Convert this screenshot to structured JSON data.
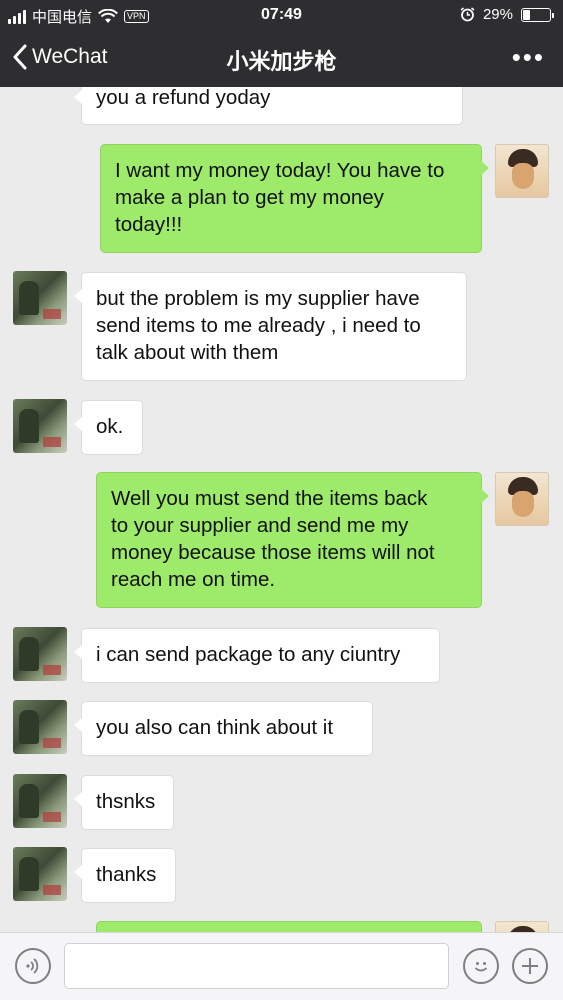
{
  "status_bar": {
    "carrier": "中国电信",
    "vpn": "VPN",
    "time": "07:49",
    "battery": "29%"
  },
  "nav": {
    "back_label": "WeChat",
    "title": "小米加步枪",
    "more": "•••"
  },
  "messages": [
    {
      "from": "them",
      "text": "you a refund yoday"
    },
    {
      "from": "me",
      "text": "I want my money today! You have to\nmake a plan to get my money\ntoday!!!"
    },
    {
      "from": "them",
      "text": "but the problem is my supplier have\nsend items to me already , i need to\ntalk about with them"
    },
    {
      "from": "them",
      "text": "ok."
    },
    {
      "from": "me",
      "text": "Well you must send the items back\nto your supplier and send me my\nmoney because those items will not\nreach me on time."
    },
    {
      "from": "them",
      "text": "i can send package to any ciuntry"
    },
    {
      "from": "them",
      "text": "you also can think about it"
    },
    {
      "from": "them",
      "text": "thsnks"
    },
    {
      "from": "them",
      "text": "thanks"
    },
    {
      "from": "me",
      "text": ""
    }
  ],
  "input_bar": {
    "voice_icon": "voice-icon",
    "emoji_icon": "emoji-icon",
    "plus_icon": "plus-icon",
    "text_value": ""
  },
  "colors": {
    "bar_bg": "#2e2e30",
    "chat_bg": "#ebebeb",
    "outgoing_bubble": "#9eea6a",
    "incoming_bubble": "#ffffff"
  }
}
